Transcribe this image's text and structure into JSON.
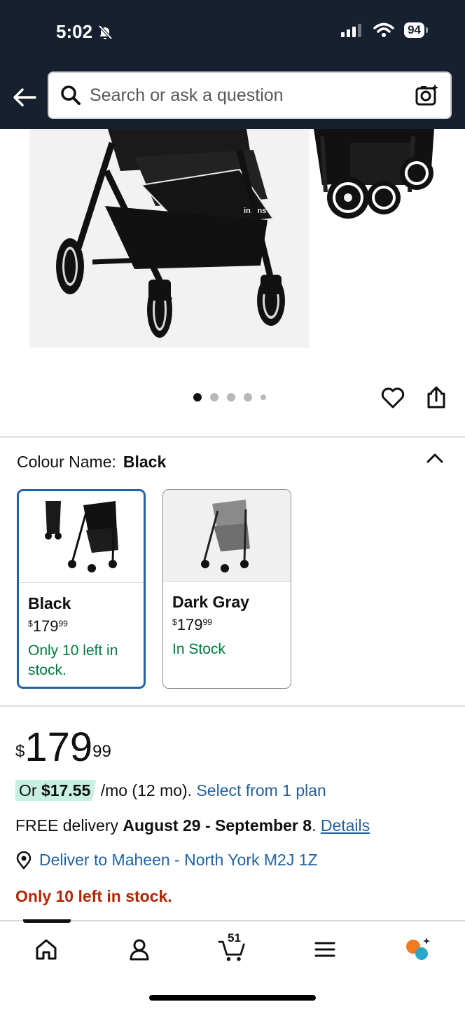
{
  "status_bar": {
    "time": "5:02",
    "battery": "94"
  },
  "search": {
    "placeholder": "Search or ask a question"
  },
  "gallery": {
    "brand_mark": "infans",
    "dot_count": 5,
    "active_dot": 0
  },
  "colour": {
    "label": "Colour Name:",
    "selected": "Black",
    "options": [
      {
        "name": "Black",
        "currency": "$",
        "price_whole": "179",
        "price_cents": "99",
        "stock": "Only 10 left in stock."
      },
      {
        "name": "Dark Gray",
        "currency": "$",
        "price_whole": "179",
        "price_cents": "99",
        "stock": "In Stock"
      }
    ]
  },
  "price": {
    "currency": "$",
    "whole": "179",
    "cents": "99"
  },
  "financing": {
    "prefix": "Or ",
    "amount": "$17.55",
    "term": " /mo (12 mo). ",
    "link": "Select from 1 plan"
  },
  "delivery": {
    "prefix": "FREE delivery ",
    "dates": "August 29 - September 8",
    "suffix": ". ",
    "link": "Details"
  },
  "deliver_to": {
    "text": "Deliver to Maheen - North York M2J 1Z"
  },
  "stock_warning": "Only 10 left in stock.",
  "bottom_nav": {
    "cart_count": "51"
  },
  "colors": {
    "header_bg": "#16202f",
    "link": "#2162a1",
    "in_stock": "#007a3d",
    "warning": "#b12704",
    "financing_pill": "#c9efe1"
  }
}
